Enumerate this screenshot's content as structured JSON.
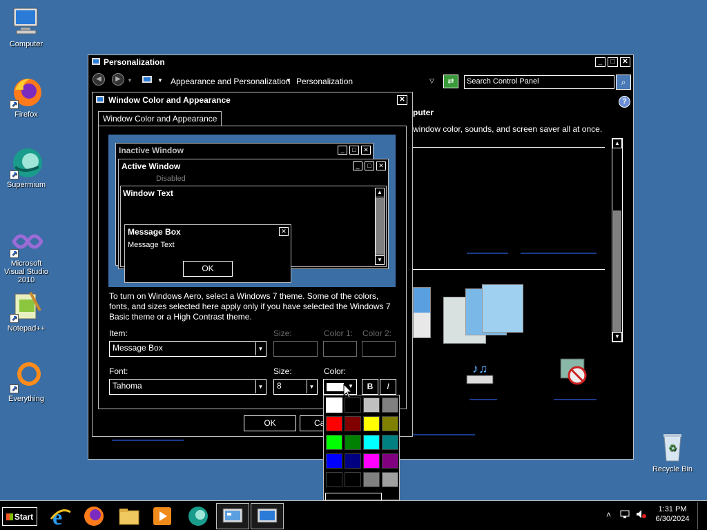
{
  "desktop": {
    "icons": [
      {
        "label": "Computer"
      },
      {
        "label": "Firefox"
      },
      {
        "label": "Supermium"
      },
      {
        "label": "Microsoft Visual Studio 2010"
      },
      {
        "label": "Notepad++"
      },
      {
        "label": "Everything"
      },
      {
        "label": "Recycle Bin"
      }
    ]
  },
  "personalization": {
    "title": "Personalization",
    "breadcrumbs": [
      "Appearance and Personalization",
      "Personalization"
    ],
    "search_placeholder": "Search Control Panel",
    "heading_partial": "puter",
    "desc_partial": "window color, sounds, and screen saver all at once."
  },
  "dialog": {
    "title": "Window Color and Appearance",
    "tab": "Window Color and Appearance",
    "preview": {
      "inactive_title": "Inactive Window",
      "active_title": "Active Window",
      "disabled": "Disabled",
      "window_text": "Window Text",
      "msgbox_title": "Message Box",
      "msgbox_text": "Message Text",
      "ok": "OK"
    },
    "info": "To turn on Windows Aero, select a Windows 7 theme.  Some of the colors, fonts, and sizes selected here apply only if you have selected the Windows 7 Basic theme or a High Contrast theme.",
    "item_label": "Item:",
    "item_value": "Message Box",
    "size1_label": "Size:",
    "color1_label": "Color 1:",
    "color2_label": "Color 2:",
    "font_label": "Font:",
    "font_value": "Tahoma",
    "size2_label": "Size:",
    "size2_value": "8",
    "color_label": "Color:",
    "bold": "B",
    "italic": "I",
    "ok": "OK",
    "cancel_partial": "Ca"
  },
  "palette": {
    "colors": [
      "#ffffff",
      "#000000",
      "#c0c0c0",
      "#808080",
      "#ff0000",
      "#800000",
      "#ffff00",
      "#808000",
      "#00ff00",
      "#008000",
      "#00ffff",
      "#008080",
      "#0000ff",
      "#000080",
      "#ff00ff",
      "#800080",
      "#000000",
      "#000000",
      "#808080",
      "#a0a0a0"
    ],
    "selected_index": 0
  },
  "taskbar": {
    "start": "Start",
    "time": "1:31 PM",
    "date": "6/30/2024"
  }
}
